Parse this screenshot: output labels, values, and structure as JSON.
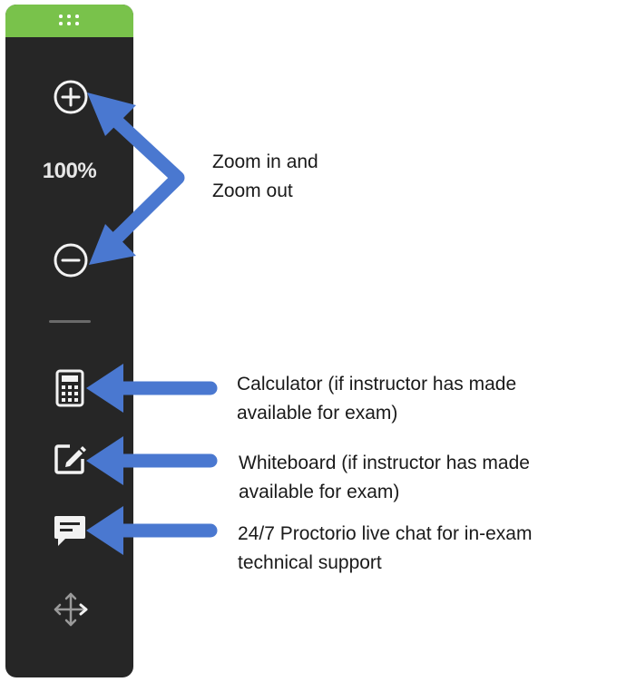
{
  "toolbar": {
    "zoom_level": "100%",
    "items": {
      "zoom_in": "plus-circle-icon",
      "zoom_out": "minus-circle-icon",
      "calculator": "calculator-icon",
      "whiteboard": "edit-square-icon",
      "chat": "chat-bubble-icon",
      "move": "move-arrows-icon"
    },
    "colors": {
      "background": "#262626",
      "grip": "#79c24b",
      "icon": "#f2f2f2"
    }
  },
  "annotations": {
    "zoom": [
      "Zoom in and",
      "Zoom out"
    ],
    "calculator": [
      "Calculator (if instructor has made",
      "available for exam)"
    ],
    "whiteboard": [
      "Whiteboard (if instructor has made",
      "available for exam)"
    ],
    "chat": [
      "24/7 Proctorio live chat for in-exam",
      "technical support"
    ],
    "arrow_color": "#4a78d0"
  }
}
